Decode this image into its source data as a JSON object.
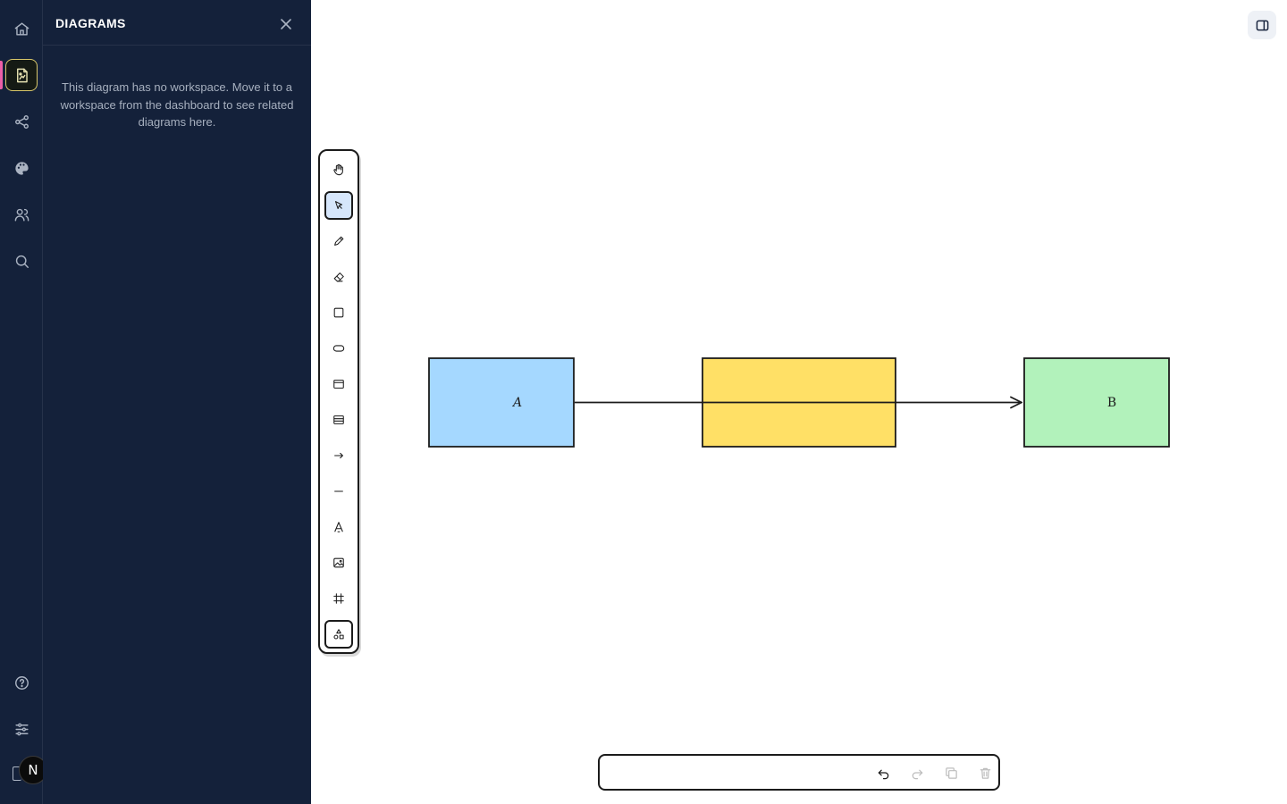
{
  "sidebar_panel": {
    "title": "DIAGRAMS",
    "empty_message": "This diagram has no workspace. Move it to a workspace from the dashboard to see related diagrams here."
  },
  "rail": {
    "items": [
      {
        "icon": "home-icon"
      },
      {
        "icon": "diagram-file-icon",
        "active": true
      },
      {
        "icon": "share-icon"
      },
      {
        "icon": "palette-icon"
      },
      {
        "icon": "users-icon"
      },
      {
        "icon": "search-icon"
      }
    ],
    "bottom_items": [
      {
        "icon": "help-icon"
      },
      {
        "icon": "settings-sliders-icon"
      }
    ],
    "avatar_initial": "N"
  },
  "toolbar": {
    "tools": [
      "hand",
      "select",
      "pencil",
      "eraser",
      "rectangle",
      "ellipse",
      "frame",
      "table",
      "arrow",
      "line",
      "text",
      "image",
      "crop",
      "shapes"
    ],
    "active_tool": "select"
  },
  "diagram": {
    "nodes": [
      {
        "id": "A",
        "label": "A",
        "fill": "#a5d8ff"
      },
      {
        "id": "mid",
        "label": "",
        "fill": "#ffe066"
      },
      {
        "id": "B",
        "label": "B",
        "fill": "#b2f2bb"
      }
    ],
    "stroke_color": "#1b1b1b"
  },
  "bottom_bar": {
    "actions": [
      "undo",
      "redo",
      "duplicate",
      "delete"
    ]
  },
  "colors": {
    "sidebar_bg": "#14213a",
    "accent_active": "#ec5fa7",
    "active_tool_bg": "#d6e6fb"
  }
}
